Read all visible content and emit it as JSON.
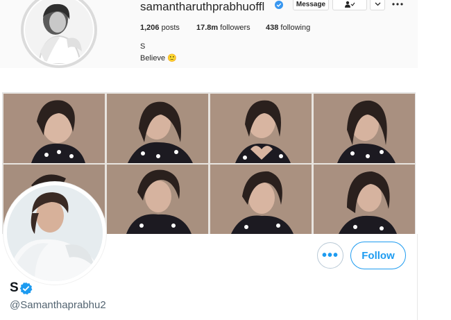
{
  "instagram": {
    "username": "samantharuthprabhuoffl",
    "message_label": "Message",
    "follow_icon_glyph": "👤✓",
    "dropdown_glyph": "⌄",
    "more_glyph": "•••",
    "stats": {
      "posts_count": "1,206",
      "posts_label": "posts",
      "followers_count": "17.8m",
      "followers_label": "followers",
      "following_count": "438",
      "following_label": "following"
    },
    "name": "S",
    "bio": "Believe 🙂",
    "verified_color": "#3897f0"
  },
  "twitter": {
    "name": "S",
    "handle": "@Samanthaprabhu2",
    "more_label": "•••",
    "follow_label": "Follow",
    "accent_color": "#1d9bf0"
  },
  "icons": [
    "verified-badge-icon",
    "person-check-icon",
    "chevron-down-icon",
    "more-options-icon"
  ]
}
